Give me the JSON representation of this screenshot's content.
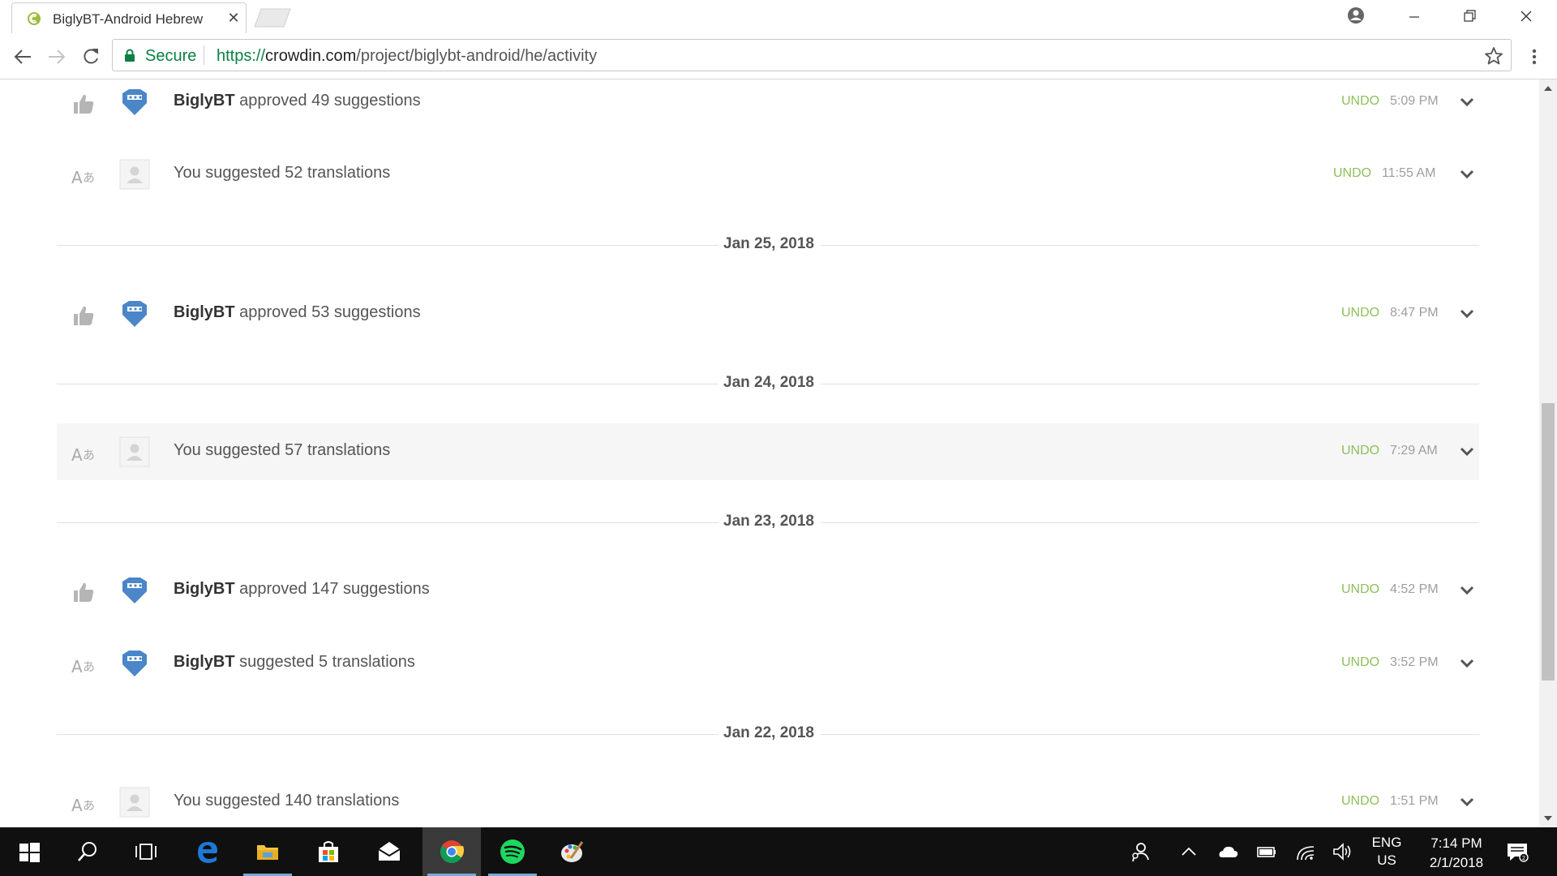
{
  "tab": {
    "title": "BiglyBT-Android Hebrew",
    "close_glyph": "✕"
  },
  "window_controls": [
    "account-icon",
    "minimize-icon",
    "restore-icon",
    "close-icon"
  ],
  "address_bar": {
    "secure_label": "Secure",
    "url_scheme": "https://",
    "url_host": "crowdin.com",
    "url_path": "/project/biglybt-android/he/activity"
  },
  "activity": {
    "undo_label": "UNDO",
    "items": [
      {
        "kind": "approved",
        "actor": "BiglyBT",
        "text": " approved 49 suggestions",
        "time": "5:09 PM"
      },
      {
        "kind": "suggested",
        "actor": "",
        "text": "You suggested 52 translations",
        "time": "11:55 AM"
      },
      {
        "kind": "date",
        "label": "Jan 25, 2018"
      },
      {
        "kind": "approved",
        "actor": "BiglyBT",
        "text": " approved 53 suggestions",
        "time": "8:47 PM"
      },
      {
        "kind": "date",
        "label": "Jan 24, 2018"
      },
      {
        "kind": "suggested",
        "actor": "",
        "text": "You suggested 57 translations",
        "time": "7:29 AM",
        "highlight": true
      },
      {
        "kind": "date",
        "label": "Jan 23, 2018"
      },
      {
        "kind": "approved",
        "actor": "BiglyBT",
        "text": " approved 147 suggestions",
        "time": "4:52 PM"
      },
      {
        "kind": "suggested-bot",
        "actor": "BiglyBT",
        "text": " suggested 5 translations",
        "time": "3:52 PM"
      },
      {
        "kind": "date",
        "label": "Jan 22, 2018"
      },
      {
        "kind": "suggested",
        "actor": "",
        "text": "You suggested 140 translations",
        "time": "1:51 PM"
      }
    ]
  },
  "taskbar": {
    "apps": [
      "start-icon",
      "search-icon",
      "task-view-icon",
      "edge-icon",
      "file-explorer-icon",
      "store-icon",
      "mail-icon",
      "chrome-icon",
      "spotify-icon",
      "paint-icon"
    ],
    "active_app": "chrome-icon",
    "tray": {
      "lang_line1": "ENG",
      "lang_line2": "US",
      "time": "7:14 PM",
      "date": "2/1/2018"
    }
  },
  "colors": {
    "secure_green": "#0b8043",
    "undo_green": "#8ebf5b",
    "crowdin_blue": "#4a86c8",
    "taskbar_bg": "#101010"
  }
}
